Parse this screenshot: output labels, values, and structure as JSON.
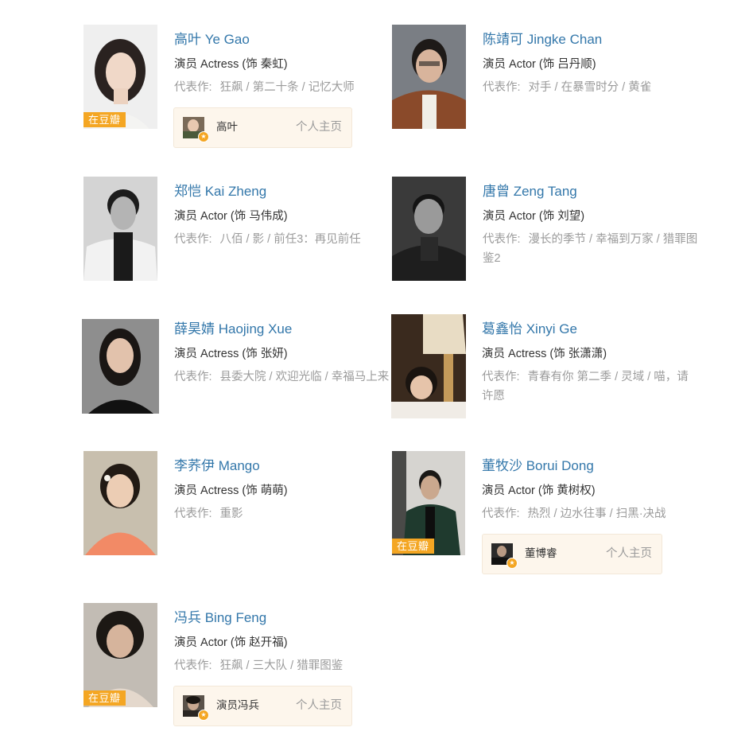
{
  "badge_label": "在豆瓣",
  "works_label": "代表作:",
  "profile_link_label": "个人主页",
  "accent_colors": {
    "link": "#3377aa",
    "badge": "#f4a623",
    "card_bg": "#fdf6ec"
  },
  "celebrities": [
    {
      "name": "高叶 Ye Gao",
      "role": "演员 Actress (饰 秦虹)",
      "works": [
        "狂飙",
        "第二十条",
        "记忆大师"
      ],
      "on_douban": true,
      "profile": {
        "name": "高叶"
      }
    },
    {
      "name": "陈靖可 Jingke Chan",
      "role": "演员 Actor (饰 吕丹顺)",
      "works": [
        "对手",
        "在暴雪时分",
        "黄雀"
      ],
      "on_douban": false
    },
    {
      "name": "郑恺 Kai Zheng",
      "role": "演员 Actor (饰 马伟成)",
      "works": [
        "八佰",
        "影",
        "前任3：再见前任"
      ],
      "on_douban": false
    },
    {
      "name": "唐曾 Zeng Tang",
      "role": "演员 Actor (饰 刘望)",
      "works": [
        "漫长的季节",
        "幸福到万家",
        "猎罪图鉴2"
      ],
      "on_douban": false
    },
    {
      "name": "薛昊婧 Haojing Xue",
      "role": "演员 Actress (饰 张妍)",
      "works": [
        "县委大院",
        "欢迎光临",
        "幸福马上来"
      ],
      "on_douban": false
    },
    {
      "name": "葛鑫怡 Xinyi Ge",
      "role": "演员 Actress (饰 张潇潇)",
      "works": [
        "青春有你 第二季",
        "灵域",
        "喵，请许愿"
      ],
      "on_douban": false
    },
    {
      "name": "李荞伊 Mango",
      "role": "演员 Actress (饰 萌萌)",
      "works": [
        "重影"
      ],
      "on_douban": false
    },
    {
      "name": "董牧沙 Borui Dong",
      "role": "演员 Actor (饰 黄树权)",
      "works": [
        "热烈",
        "边水往事",
        "扫黑·决战"
      ],
      "on_douban": true,
      "profile": {
        "name": "董博睿"
      }
    },
    {
      "name": "冯兵 Bing Feng",
      "role": "演员 Actor (饰 赵开福)",
      "works": [
        "狂飙",
        "三大队",
        "猎罪图鉴"
      ],
      "on_douban": true,
      "profile": {
        "name": "演员冯兵"
      }
    }
  ]
}
